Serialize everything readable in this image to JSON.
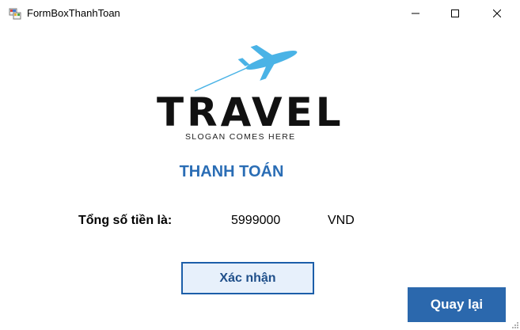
{
  "window": {
    "title": "FormBoxThanhToan",
    "icon": "winforms-app-icon",
    "controls": [
      "minimize-icon",
      "maximize-icon",
      "close-icon"
    ]
  },
  "logo": {
    "wordmark": "TRAVEL",
    "slogan": "SLOGAN COMES HERE",
    "accent_color": "#4ab3e6"
  },
  "heading": "THANH TOÁN",
  "total": {
    "label": "Tổng số tiền là:",
    "value": "5999000",
    "unit": "VND"
  },
  "buttons": {
    "confirm_label": "Xác nhận",
    "back_label": "Quay lại"
  },
  "colors": {
    "heading": "#2a6db5",
    "confirm_border": "#1c5ea9",
    "back_bg": "#2b68ad"
  }
}
